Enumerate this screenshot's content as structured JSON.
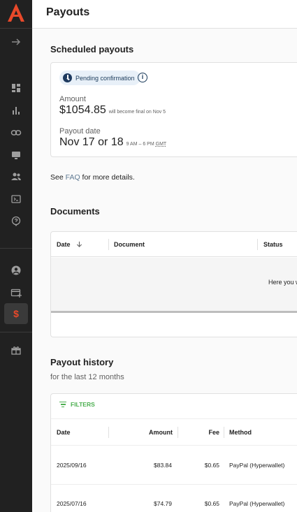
{
  "app": {
    "page_title": "Payouts",
    "brand_color": "#e8492a"
  },
  "sidebar": {
    "items": [
      {
        "icon": "arrow-right-icon"
      },
      {
        "icon": "dashboard-icon"
      },
      {
        "icon": "bar-chart-icon"
      },
      {
        "icon": "link-icon"
      },
      {
        "icon": "monitor-icon"
      },
      {
        "icon": "users-icon"
      },
      {
        "icon": "terminal-icon"
      },
      {
        "icon": "help-icon"
      },
      {
        "icon": "account-icon"
      },
      {
        "icon": "credit-card-add-icon"
      },
      {
        "icon": "dollar-icon",
        "active": true
      },
      {
        "icon": "gift-icon"
      }
    ]
  },
  "scheduled": {
    "title": "Scheduled payouts",
    "status": "Pending confirmation",
    "amount_label": "Amount",
    "amount": "$1054.85",
    "amount_note": "will become final on Nov 5",
    "date_label": "Payout date",
    "date": "Nov 17 or 18",
    "time": "9 AM – 6 PM",
    "tz": "GMT"
  },
  "faq": {
    "before": "See ",
    "link": "FAQ",
    "after": " for more details."
  },
  "documents": {
    "title": "Documents",
    "columns": [
      "Date",
      "Document",
      "Status"
    ],
    "empty_text": "Here you w"
  },
  "history": {
    "title": "Payout history",
    "subtitle": "for the last 12 months",
    "filters_label": "FILTERS",
    "columns": [
      "Date",
      "Amount",
      "Fee",
      "Method"
    ],
    "rows": [
      {
        "date": "2025/09/16",
        "amount": "$83.84",
        "fee": "$0.65",
        "method": "PayPal (Hyperwallet)"
      },
      {
        "date": "2025/07/16",
        "amount": "$74.79",
        "fee": "$0.65",
        "method": "PayPal (Hyperwallet)"
      }
    ]
  }
}
